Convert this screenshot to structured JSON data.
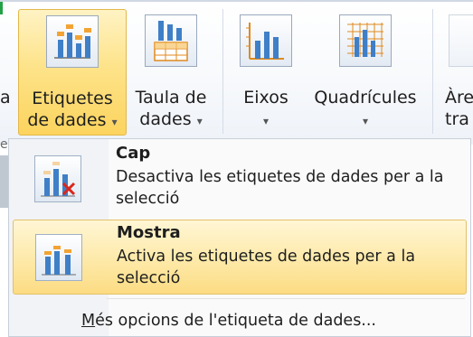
{
  "ribbon": {
    "left_cutoff": "a",
    "left_cutoff_lower": "es",
    "buttons": [
      {
        "line1": "Etiquetes",
        "line2": "de dades",
        "active": true
      },
      {
        "line1": "Taula de",
        "line2": "dades"
      },
      {
        "line1": "Eixos",
        "line2": ""
      },
      {
        "line1": "Quadrícules",
        "line2": ""
      },
      {
        "line1": "Àre",
        "line2": "tra"
      }
    ],
    "caret": "▾"
  },
  "menu": {
    "items": [
      {
        "title": "Cap",
        "desc": "Desactiva les etiquetes de dades per a la selecció",
        "icon": "data-labels-none-icon"
      },
      {
        "title": "Mostra",
        "desc": "Activa les etiquetes de dades per a la selecció",
        "icon": "data-labels-show-icon",
        "highlighted": true
      }
    ],
    "more_accel": "M",
    "more_rest": "és opcions de l'etiqueta de dades..."
  },
  "colors": {
    "highlight": "#fde38a",
    "accent_blue": "#3f7fc7",
    "accent_orange": "#f2a334",
    "delete_red": "#d9261c"
  }
}
